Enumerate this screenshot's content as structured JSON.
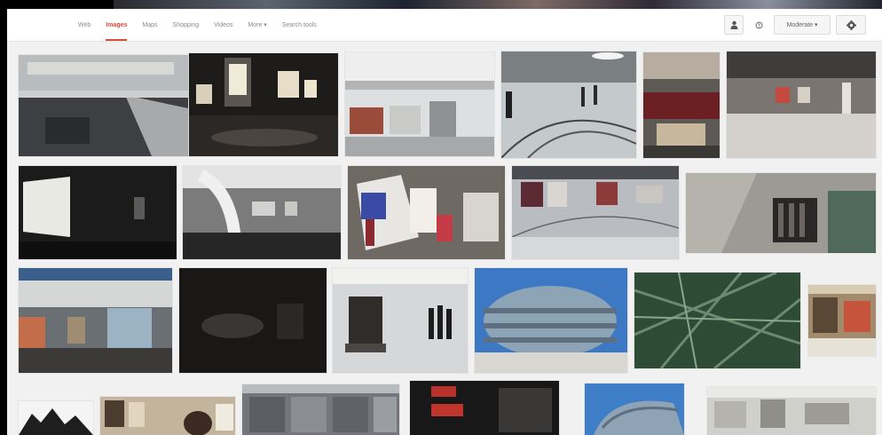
{
  "tabs": [
    {
      "label": "Web",
      "active": false
    },
    {
      "label": "Images",
      "active": true
    },
    {
      "label": "Maps",
      "active": false
    },
    {
      "label": "Shopping",
      "active": false
    },
    {
      "label": "Videos",
      "active": false
    },
    {
      "label": "More ▾",
      "active": false
    },
    {
      "label": "Search tools",
      "active": false
    }
  ],
  "tools": {
    "person_icon": "person-icon",
    "safe_icon": "safe-search-icon",
    "moderate_label": "Moderate ▾",
    "gear_icon": "gear-icon"
  },
  "colors": {
    "accent": "#dd4b39",
    "page_bg": "#f1f1f1"
  }
}
